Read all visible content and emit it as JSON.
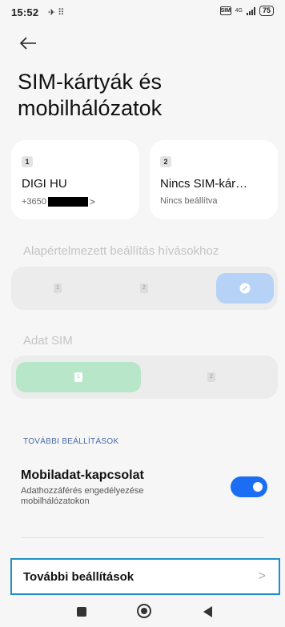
{
  "status_bar": {
    "time": "15:52",
    "left_icons": "✈ ⠿",
    "sim_label": "SIM",
    "network_label": "4G",
    "battery": "75"
  },
  "header": {
    "back_icon": "arrow-left-icon",
    "title": "SIM-kártyák és mobilhálózatok"
  },
  "sim_cards": [
    {
      "slot": "1",
      "name": "DIGI HU",
      "subtitle_prefix": "+3650",
      "subtitle_suffix": ">"
    },
    {
      "slot": "2",
      "name": "Nincs SIM-kár…",
      "subtitle": "Nincs beállítva"
    }
  ],
  "call_default": {
    "label": "Alapértelmezett beállítás hívásokhoz",
    "options": [
      "1",
      "2"
    ],
    "active_icon": "compass-icon",
    "colors": {
      "active": "#b6d2f7"
    }
  },
  "data_sim": {
    "label": "Adat SIM",
    "options": [
      "1",
      "2"
    ],
    "colors": {
      "active": "#b8e6c8"
    }
  },
  "more_section": {
    "header": "TOVÁBBI BEÁLLÍTÁSOK",
    "mobile_data": {
      "title": "Mobiladat-kapcsolat",
      "subtitle": "Adathozzáférés engedélyezése mobilhálózatokon",
      "enabled": true,
      "color": "#1b6ef3"
    }
  },
  "more_settings": {
    "label": "További beállítások",
    "chevron": ">"
  },
  "nav": {
    "icons": [
      "recents-square-icon",
      "home-circle-icon",
      "back-triangle-icon"
    ]
  }
}
